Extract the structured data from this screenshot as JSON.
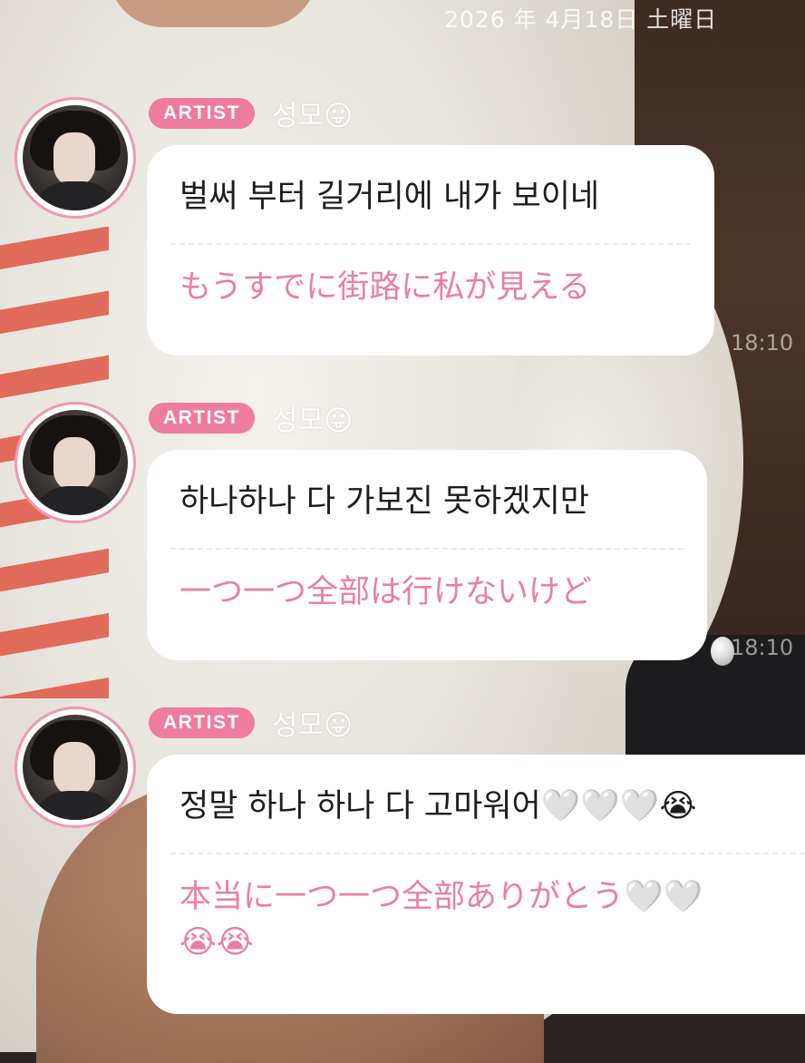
{
  "header": {
    "date": "2026 年 4月18日 土曜日"
  },
  "messages": [
    {
      "badge": "ARTIST",
      "author": "성모",
      "author_emoji": "😛",
      "korean": "벌써 부터 길거리에 내가 보이네",
      "japanese": "もうすでに街路に私が見える",
      "time": "18:10"
    },
    {
      "badge": "ARTIST",
      "author": "성모",
      "author_emoji": "😛",
      "korean": "하나하나 다 가보진 못하겠지만",
      "japanese": "一つ一つ全部は行けないけど",
      "time": "18:10"
    },
    {
      "badge": "ARTIST",
      "author": "성모",
      "author_emoji": "😛",
      "korean": "정말 하나 하나 다 고마워어🤍🤍🤍😭",
      "japanese": "本当に一つ一つ全部ありがとう🤍🤍",
      "japanese_line2": "😭😭"
    }
  ],
  "colors": {
    "badge": "#ee7c9f",
    "translation_text": "#ea7fa1",
    "avatar_ring": "#ef97b6"
  }
}
